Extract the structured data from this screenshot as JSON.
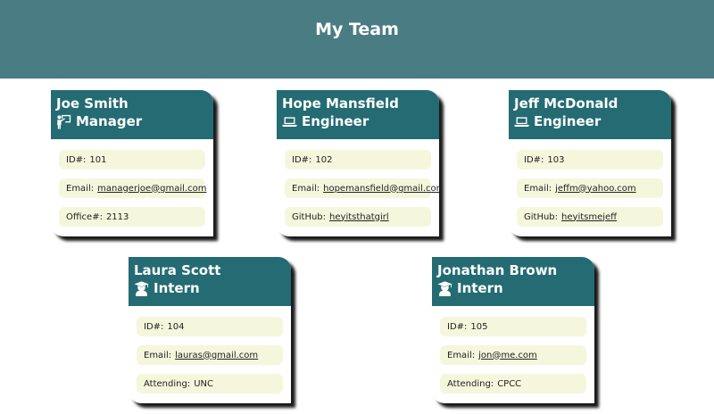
{
  "header": {
    "title": "My Team"
  },
  "cards": [
    {
      "name": "Joe Smith",
      "role": "Manager",
      "icon": "manager-icon",
      "fields": [
        {
          "label": "ID#:",
          "value": "101",
          "link": false
        },
        {
          "label": "Email:",
          "value": "managerjoe@gmail.com",
          "link": true
        },
        {
          "label": "Office#:",
          "value": "2113",
          "link": false
        }
      ]
    },
    {
      "name": "Hope Mansfield",
      "role": "Engineer",
      "icon": "laptop-icon",
      "fields": [
        {
          "label": "ID#:",
          "value": "102",
          "link": false
        },
        {
          "label": "Email:",
          "value": "hopemansfield@gmail.com",
          "link": true
        },
        {
          "label": "GitHub:",
          "value": "heyitsthatgirl",
          "link": true
        }
      ]
    },
    {
      "name": "Jeff McDonald",
      "role": "Engineer",
      "icon": "laptop-icon",
      "fields": [
        {
          "label": "ID#:",
          "value": "103",
          "link": false
        },
        {
          "label": "Email:",
          "value": "jeffm@yahoo.com",
          "link": true
        },
        {
          "label": "GitHub:",
          "value": "heyitsmejeff",
          "link": true
        }
      ]
    },
    {
      "name": "Laura Scott",
      "role": "Intern",
      "icon": "graduate-icon",
      "fields": [
        {
          "label": "ID#:",
          "value": "104",
          "link": false
        },
        {
          "label": "Email:",
          "value": "lauras@gmail.com",
          "link": true
        },
        {
          "label": "Attending:",
          "value": "UNC",
          "link": false
        }
      ]
    },
    {
      "name": "Jonathan Brown",
      "role": "Intern",
      "icon": "graduate-icon",
      "fields": [
        {
          "label": "ID#:",
          "value": "105",
          "link": false
        },
        {
          "label": "Email:",
          "value": "jon@me.com",
          "link": true
        },
        {
          "label": "Attending:",
          "value": "CPCC",
          "link": false
        }
      ]
    }
  ]
}
